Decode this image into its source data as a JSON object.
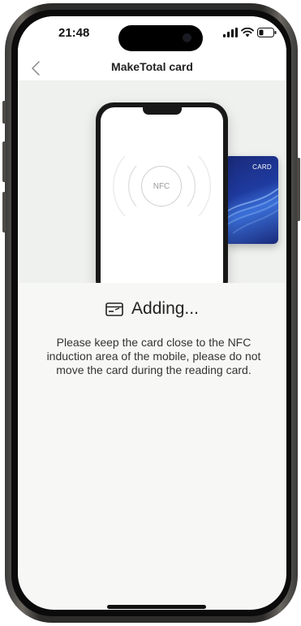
{
  "status_bar": {
    "time": "21:48",
    "icons": [
      "signal-icon",
      "wifi-icon",
      "battery-icon"
    ]
  },
  "nav": {
    "back_icon": "chevron-left-icon",
    "title": "MakeTotal card"
  },
  "illustration": {
    "nfc_label": "NFC",
    "card_label": "CARD"
  },
  "content": {
    "status_icon": "card-icon",
    "status_text": "Adding...",
    "instruction": "Please keep the card close to the NFC induction area of the mobile, please do not move the card during the reading card."
  },
  "colors": {
    "background": "#f7f8f6",
    "card_blue": "#1f3ba0",
    "text": "#222222"
  }
}
